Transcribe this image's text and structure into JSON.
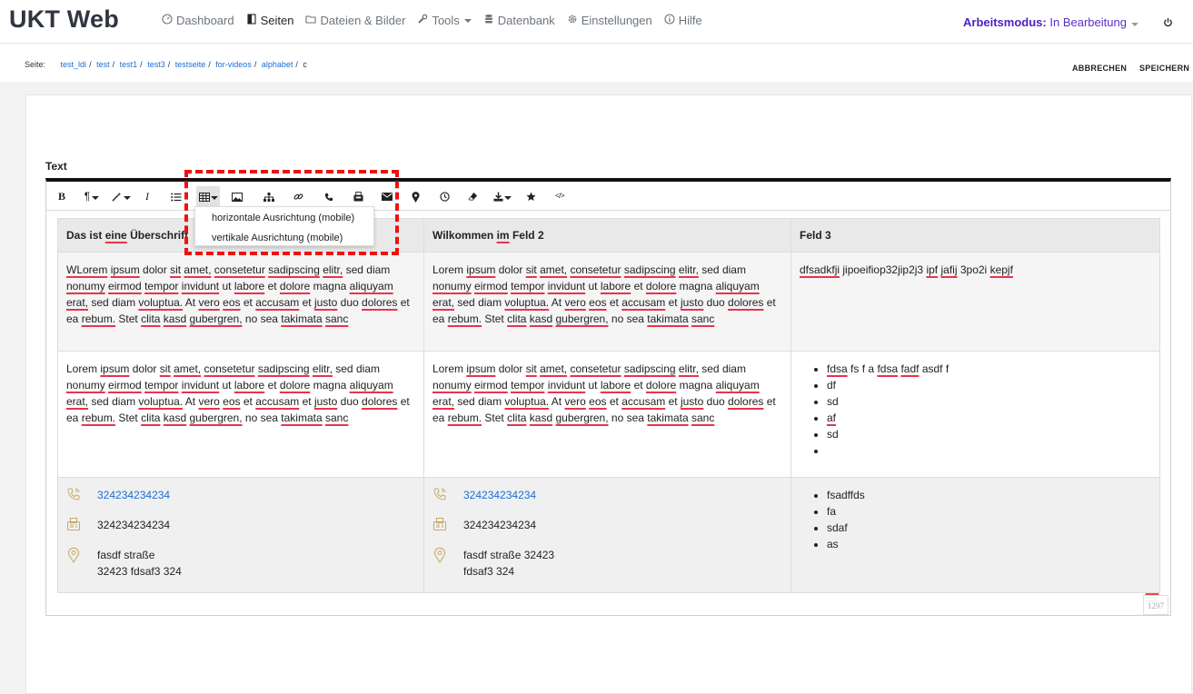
{
  "app": {
    "brand": "UKT Web"
  },
  "nav": {
    "items": [
      {
        "label": "Dashboard",
        "icon": "dashboard-icon"
      },
      {
        "label": "Seiten",
        "icon": "page-icon"
      },
      {
        "label": "Dateien & Bilder",
        "icon": "folder-icon"
      },
      {
        "label": "Tools",
        "icon": "wrench-icon"
      },
      {
        "label": "Datenbank",
        "icon": "database-icon"
      },
      {
        "label": "Einstellungen",
        "icon": "gear-icon"
      },
      {
        "label": "Hilfe",
        "icon": "info-icon"
      }
    ],
    "mode_label": "Arbeitsmodus:",
    "mode_value": "In Bearbeitung"
  },
  "breadcrumb": {
    "label": "Seite:",
    "items": [
      "test_ldi",
      "test",
      "test1",
      "test3",
      "testseite",
      "for-videos",
      "alphabet",
      "c"
    ]
  },
  "actions": {
    "cancel": "ABBRECHEN",
    "save": "SPEICHERN"
  },
  "editor": {
    "field_label": "Text",
    "table_dropdown": [
      "horizontale Ausrichtung (mobile)",
      "vertikale Ausrichtung (mobile)"
    ],
    "char_count": "1297"
  },
  "table": {
    "headers": [
      "Das ist eine Überschrift",
      "Wilkommen im Feld 2",
      "Feld 3"
    ],
    "row1": {
      "c1": "WLorem ipsum dolor sit amet, consetetur sadipscing elitr, sed diam nonumy eirmod tempor invidunt ut labore et dolore magna aliquyam erat, sed diam voluptua. At vero eos et accusam et justo duo dolores et ea rebum. Stet clita kasd gubergren, no sea takimata sanc",
      "c2": "Lorem ipsum dolor sit amet, consetetur sadipscing elitr, sed diam nonumy eirmod tempor invidunt ut labore et dolore magna aliquyam erat, sed diam voluptua. At vero eos et accusam et justo duo dolores et ea rebum. Stet clita kasd gubergren, no sea takimata sanc",
      "c3": "dfsadkfji jipoeifiop32jip2j3 ipf jafij 3po2i kepjf"
    },
    "row2": {
      "c1": "Lorem ipsum dolor sit amet, consetetur sadipscing elitr, sed diam nonumy eirmod tempor invidunt ut labore et dolore magna aliquyam erat, sed diam voluptua. At vero eos et accusam et justo duo dolores et ea rebum. Stet clita kasd gubergren, no sea takimata sanc",
      "c2": "Lorem ipsum dolor sit amet, consetetur sadipscing elitr, sed diam nonumy eirmod tempor invidunt ut labore et dolore magna aliquyam erat, sed diam voluptua. At vero eos et accusam et justo duo dolores et ea rebum. Stet clita kasd gubergren, no sea takimata sanc",
      "list": [
        "fdsa fs f a fdsa fadf asdf f",
        "df",
        "sd",
        "af",
        "sd",
        ""
      ]
    },
    "row3": {
      "c1": {
        "phone": "324234234234",
        "fax": "324234234234",
        "addr1": "fasdf straße",
        "addr2": "32423 fdsaf3 324"
      },
      "c2": {
        "phone": "324234234234",
        "fax": "324234234234",
        "addr1": "fasdf straße 32423",
        "addr2": "fdsaf3 324"
      },
      "list": [
        "fsadffds",
        "fa",
        "sdaf",
        "as"
      ]
    }
  }
}
